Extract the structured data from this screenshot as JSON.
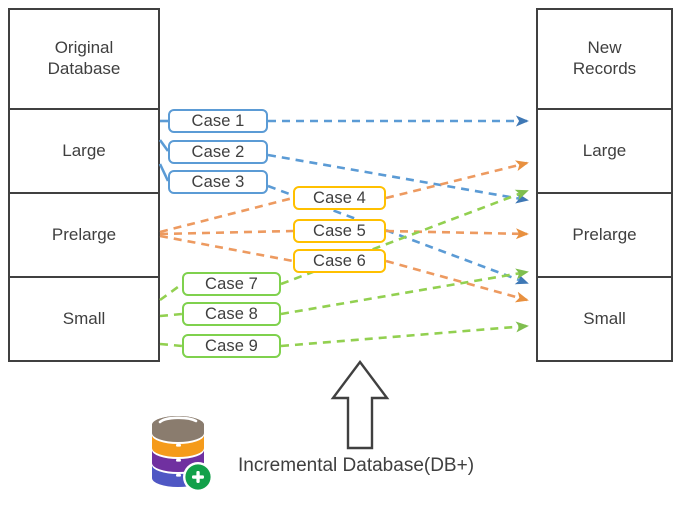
{
  "diagram": {
    "title_hidden": "",
    "left_column": {
      "header": "Original\nDatabase",
      "header_line1": "Original",
      "header_line2": "Database",
      "rows": [
        "Large",
        "Prelarge",
        "Small"
      ]
    },
    "right_column": {
      "header_line1": "New",
      "header_line2": "Records",
      "rows": [
        "Large",
        "Prelarge",
        "Small"
      ]
    },
    "cases": {
      "blue_group": [
        "Case 1",
        "Case 2",
        "Case 3"
      ],
      "yellow_group": [
        "Case 4",
        "Case 5",
        "Case 6"
      ],
      "green_group": [
        "Case 7",
        "Case 8",
        "Case 9"
      ]
    },
    "bottom": {
      "caption": "Incremental Database(DB+)",
      "arrow_icon": "up-arrow-icon",
      "database_icon": "incremental-database-icon"
    },
    "colors": {
      "blue": "#5b9bd5",
      "orange": "#ed9a60",
      "green": "#92d050",
      "yellow": "#ffc000",
      "outline": "#404040",
      "text": "#3f3f3f",
      "db_top": "#8a7c6e",
      "db_orange": "#f59b1b",
      "db_purple": "#7030a0",
      "db_blue": "#4f57c4",
      "db_badge": "#13a04a"
    }
  },
  "chart_data": {
    "type": "diagram",
    "title": "Incremental database record classification mapping",
    "nodes": {
      "source_partitions": [
        "Large",
        "Prelarge",
        "Small"
      ],
      "target_partitions": [
        "Large",
        "Prelarge",
        "Small"
      ],
      "case_labels": [
        "Case 1",
        "Case 2",
        "Case 3",
        "Case 4",
        "Case 5",
        "Case 6",
        "Case 7",
        "Case 8",
        "Case 9"
      ]
    },
    "edges": [
      {
        "case": "Case 1",
        "from": "Large",
        "to": "Large",
        "color": "#5b9bd5"
      },
      {
        "case": "Case 2",
        "from": "Large",
        "to": "Prelarge",
        "color": "#5b9bd5"
      },
      {
        "case": "Case 3",
        "from": "Large",
        "to": "Small",
        "color": "#5b9bd5"
      },
      {
        "case": "Case 4",
        "from": "Prelarge",
        "to": "Large",
        "color": "#ed9a60"
      },
      {
        "case": "Case 5",
        "from": "Prelarge",
        "to": "Prelarge",
        "color": "#ed9a60"
      },
      {
        "case": "Case 6",
        "from": "Prelarge",
        "to": "Small",
        "color": "#ed9a60"
      },
      {
        "case": "Case 7",
        "from": "Small",
        "to": "Large",
        "color": "#92d050"
      },
      {
        "case": "Case 8",
        "from": "Small",
        "to": "Prelarge",
        "color": "#92d050"
      },
      {
        "case": "Case 9",
        "from": "Small",
        "to": "Small",
        "color": "#92d050"
      }
    ]
  }
}
